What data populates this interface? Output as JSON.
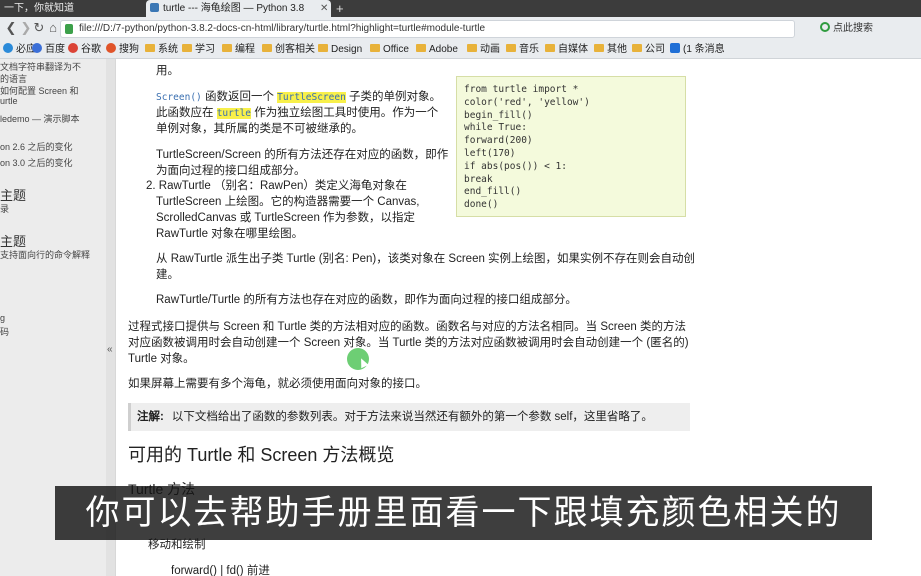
{
  "tabs": [
    {
      "label": "一下，你就知道"
    },
    {
      "label": "turtle --- 海龟绘图 — Python 3.8",
      "close": "✕"
    }
  ],
  "new_tab": "+",
  "nav": {
    "back": "❮",
    "forward": "❯",
    "reload": "↻",
    "home": "⌂"
  },
  "url": "file:///D:/7-python/python-3.8.2-docs-cn-html/library/turtle.html?highlight=turtle#module-turtle",
  "search_label": "点此搜索",
  "bookmarks": [
    {
      "label": "必应"
    },
    {
      "label": "百度"
    },
    {
      "label": "谷歌"
    },
    {
      "label": "搜狗"
    },
    {
      "label": "系统"
    },
    {
      "label": "学习"
    },
    {
      "label": "编程"
    },
    {
      "label": "创客相关"
    },
    {
      "label": "Design"
    },
    {
      "label": "Office"
    },
    {
      "label": "Adobe"
    },
    {
      "label": "动画"
    },
    {
      "label": "音乐"
    },
    {
      "label": "自媒体"
    },
    {
      "label": "其他"
    },
    {
      "label": "公司"
    },
    {
      "label": "(1 条消息"
    }
  ],
  "sidebar": [
    {
      "text": "文档字符串翻译为不"
    },
    {
      "text": "的语言"
    },
    {
      "text": "如何配置 Screen 和"
    },
    {
      "text": "urtle"
    },
    {
      "text": "ledemo — 演示脚本"
    },
    {
      "text": "on 2.6 之后的变化"
    },
    {
      "text": "on 3.0 之后的变化"
    },
    {
      "text": "主题"
    },
    {
      "text": "录"
    },
    {
      "text": "主题"
    },
    {
      "text": "支持面向行的命令解释"
    },
    {
      "text": "g"
    },
    {
      "text": "码"
    }
  ],
  "splitter_icon": "«",
  "content": {
    "p0": "用。",
    "p1a": "Screen()",
    "p1b": " 函数返回一个 ",
    "p1c": "TurtleScreen",
    "p1d": " 子类的单例对象。",
    "p1e": "此函数应在 ",
    "p1f": "turtle",
    "p1g": " 作为独立绘图工具时使用。作为一个",
    "p1h": "单例对象，其所属的类是不可被继承的。",
    "p2a": "TurtleScreen/Screen 的所有方法还存在对应的函数，即作",
    "p2b": "为面向过程的接口组成部分。",
    "li2a": "2. RawTurtle （别名：RawPen）类定义海龟对象在",
    "li2b": "TurtleScreen 上绘图。它的构造器需要一个 Canvas,",
    "li2c": "ScrolledCanvas 或 TurtleScreen 作为参数，以指定",
    "li2d": "RawTurtle 对象在哪里绘图。",
    "p3": "从 RawTurtle 派生出子类 Turtle (别名: Pen)，该类对象在 Screen 实例上绘图，如果实例不存在则会自动创",
    "p3b": "建。",
    "p4": "RawTurtle/Turtle 的所有方法也存在对应的函数，即作为面向过程的接口组成部分。",
    "p5a": "过程式接口提供与 Screen 和 Turtle 类的方法相对应的函数。函数名与对应的方法名相同。当 Screen 类的方法",
    "p5b": "对应函数被调用时会自动创建一个 Screen 对象。当 Turtle 类的方法对应函数被调用时会自动创建一个 (匿名的)",
    "p5c": "Turtle 对象。",
    "p6": "如果屏幕上需要有多个海龟，就必须使用面向对象的接口。",
    "note_label": "注解:",
    "note_text": "以下文档给出了函数的参数列表。对于方法来说当然还有额外的第一个参数 self，这里省略了。",
    "h2": "可用的 Turtle 和 Screen 方法概览",
    "h3": "Turtle 方法",
    "sub1": "移动和绘制",
    "code_tail": "forward() | fd()  前进"
  },
  "code": [
    "from turtle import *",
    "color('red', 'yellow')",
    "begin_fill()",
    "while True:",
    "    forward(200)",
    "    left(170)",
    "    if abs(pos()) < 1:",
    "        break",
    "end_fill()",
    "done()"
  ],
  "subtitle": "你可以去帮助手册里面看一下跟填充颜色相关的"
}
